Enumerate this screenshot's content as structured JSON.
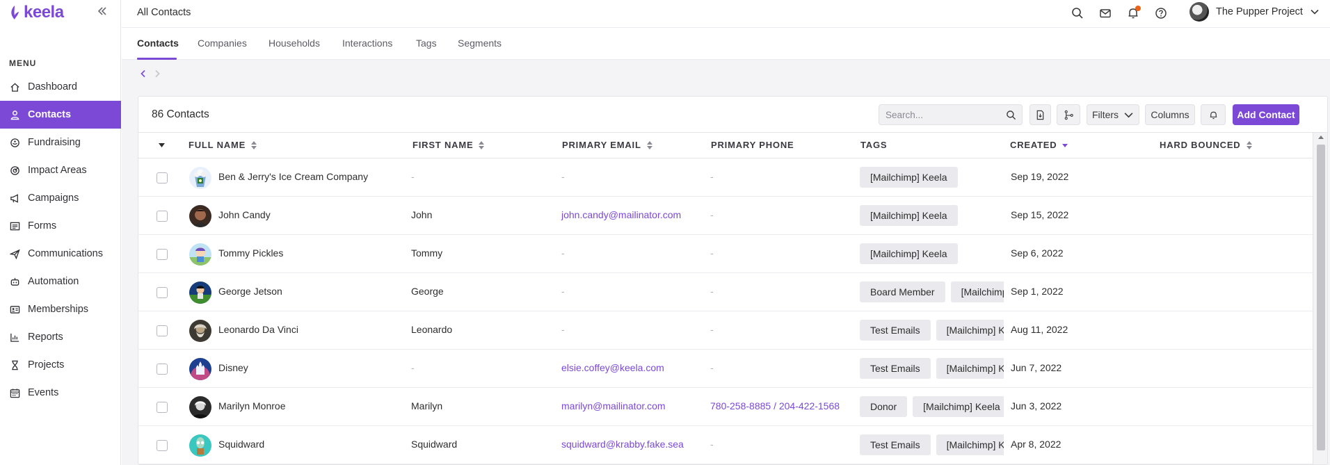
{
  "brand": {
    "name": "keela",
    "accent": "#7b49d6"
  },
  "sidebar": {
    "menu_title": "MENU",
    "items": [
      {
        "label": "Dashboard",
        "icon": "home-icon"
      },
      {
        "label": "Contacts",
        "icon": "user-icon",
        "active": true
      },
      {
        "label": "Fundraising",
        "icon": "donation-icon"
      },
      {
        "label": "Impact Areas",
        "icon": "target-icon"
      },
      {
        "label": "Campaigns",
        "icon": "megaphone-icon"
      },
      {
        "label": "Forms",
        "icon": "form-icon"
      },
      {
        "label": "Communications",
        "icon": "send-icon"
      },
      {
        "label": "Automation",
        "icon": "robot-icon"
      },
      {
        "label": "Memberships",
        "icon": "id-card-icon"
      },
      {
        "label": "Reports",
        "icon": "bar-chart-icon"
      },
      {
        "label": "Projects",
        "icon": "hourglass-icon"
      },
      {
        "label": "Events",
        "icon": "calendar-icon"
      }
    ]
  },
  "topbar": {
    "title": "All Contacts",
    "org_name": "The Pupper Project"
  },
  "tabs": [
    "Contacts",
    "Companies",
    "Households",
    "Interactions",
    "Tags",
    "Segments"
  ],
  "list": {
    "count_label": "86 Contacts",
    "search_placeholder": "Search...",
    "filters_label": "Filters",
    "columns_label": "Columns",
    "add_label": "Add Contact"
  },
  "table": {
    "columns": {
      "full_name": "FULL NAME",
      "first_name": "FIRST NAME",
      "primary_email": "PRIMARY EMAIL",
      "primary_phone": "PRIMARY PHONE",
      "tags": "TAGS",
      "created": "CREATED",
      "hard_bounced": "HARD BOUNCED"
    },
    "rows": [
      {
        "full_name": "Ben & Jerry's Ice Cream Company",
        "first_name": "-",
        "email": "-",
        "phone": "-",
        "tags": [
          "[Mailchimp] Keela"
        ],
        "created": "Sep 19, 2022"
      },
      {
        "full_name": "John Candy",
        "first_name": "John",
        "email": "john.candy@mailinator.com",
        "phone": "-",
        "tags": [
          "[Mailchimp] Keela"
        ],
        "created": "Sep 15, 2022"
      },
      {
        "full_name": "Tommy Pickles",
        "first_name": "Tommy",
        "email": "-",
        "phone": "-",
        "tags": [
          "[Mailchimp] Keela"
        ],
        "created": "Sep 6, 2022"
      },
      {
        "full_name": "George Jetson",
        "first_name": "George",
        "email": "-",
        "phone": "-",
        "tags": [
          "Board Member",
          "[Mailchimp] Keela"
        ],
        "created": "Sep 1, 2022"
      },
      {
        "full_name": "Leonardo Da Vinci",
        "first_name": "Leonardo",
        "email": "-",
        "phone": "-",
        "tags": [
          "Test Emails",
          "[Mailchimp] Keela"
        ],
        "created": "Aug 11, 2022"
      },
      {
        "full_name": "Disney",
        "first_name": "-",
        "email": "elsie.coffey@keela.com",
        "phone": "-",
        "tags": [
          "Test Emails",
          "[Mailchimp] Keela"
        ],
        "created": "Jun 7, 2022"
      },
      {
        "full_name": "Marilyn Monroe",
        "first_name": "Marilyn",
        "email": "marilyn@mailinator.com",
        "phone": "780-258-8885 / 204-422-1568",
        "tags": [
          "Donor",
          "[Mailchimp] Keela"
        ],
        "created": "Jun 3, 2022"
      },
      {
        "full_name": "Squidward",
        "first_name": "Squidward",
        "email": "squidward@krabby.fake.sea",
        "phone": "-",
        "tags": [
          "Test Emails",
          "[Mailchimp] Keela"
        ],
        "created": "Apr 8, 2022"
      }
    ]
  }
}
